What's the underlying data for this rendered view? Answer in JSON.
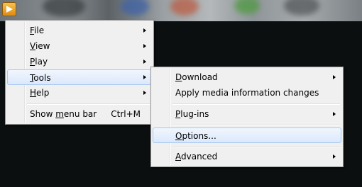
{
  "window": {
    "app_button_icon": "play-triangle-icon"
  },
  "main_menu": {
    "items": [
      {
        "pre": "",
        "key": "F",
        "post": "ile",
        "submenu": true
      },
      {
        "pre": "",
        "key": "V",
        "post": "iew",
        "submenu": true
      },
      {
        "pre": "",
        "key": "P",
        "post": "lay",
        "submenu": true
      },
      {
        "pre": "",
        "key": "T",
        "post": "ools",
        "submenu": true,
        "highlighted": true
      },
      {
        "pre": "",
        "key": "H",
        "post": "elp",
        "submenu": true
      }
    ],
    "menu_bar_item": {
      "pre": "Show ",
      "key": "m",
      "post": "enu bar",
      "shortcut": "Ctrl+M"
    }
  },
  "tools_submenu": {
    "download": {
      "pre": "",
      "key": "D",
      "post": "ownload"
    },
    "apply_media": {
      "label": "Apply media information changes"
    },
    "plugins": {
      "pre": "",
      "key": "P",
      "post": "lug-ins"
    },
    "options": {
      "pre": "",
      "key": "O",
      "post": "ptions..."
    },
    "advanced": {
      "pre": "",
      "key": "A",
      "post": "dvanced"
    }
  },
  "colors": {
    "highlight_fill": "#dbe8fb",
    "highlight_border": "#a8c8ef",
    "menu_background": "#f0f0f0",
    "app_button": "#f0a020"
  }
}
